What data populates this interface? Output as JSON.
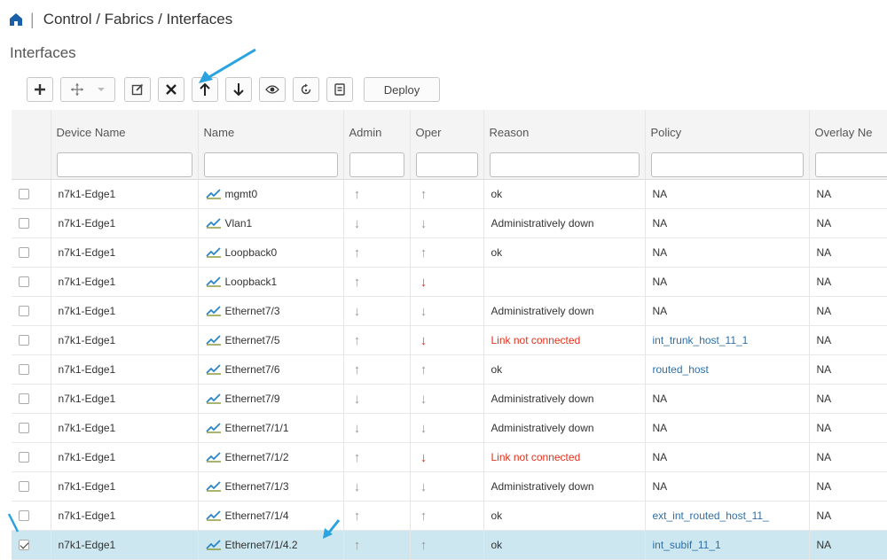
{
  "header": {
    "breadcrumb": "Control / Fabrics / Interfaces"
  },
  "section_title": "Interfaces",
  "toolbar": {
    "deploy_label": "Deploy",
    "buttons": [
      "add-icon",
      "move-icon",
      "edit-icon",
      "close-icon",
      "arrow-up-icon",
      "arrow-down-icon",
      "eye-icon",
      "refresh-icon",
      "clipboard-icon"
    ]
  },
  "table": {
    "columns": [
      "Device Name",
      "Name",
      "Admin",
      "Oper",
      "Reason",
      "Policy",
      "Overlay Ne"
    ],
    "rows": [
      {
        "device": "n7k1-Edge1",
        "name": "mgmt0",
        "admin": "up",
        "oper": "up",
        "reason": "ok",
        "policy": "NA",
        "overlay": "NA",
        "checked": false
      },
      {
        "device": "n7k1-Edge1",
        "name": "Vlan1",
        "admin": "down",
        "oper": "down",
        "reason": "Administratively down",
        "policy": "NA",
        "overlay": "NA",
        "checked": false
      },
      {
        "device": "n7k1-Edge1",
        "name": "Loopback0",
        "admin": "up",
        "oper": "up",
        "reason": "ok",
        "policy": "NA",
        "overlay": "NA",
        "checked": false
      },
      {
        "device": "n7k1-Edge1",
        "name": "Loopback1",
        "admin": "up",
        "oper": "down-red",
        "reason": "",
        "policy": "NA",
        "overlay": "NA",
        "checked": false
      },
      {
        "device": "n7k1-Edge1",
        "name": "Ethernet7/3",
        "admin": "down",
        "oper": "down",
        "reason": "Administratively down",
        "policy": "NA",
        "overlay": "NA",
        "checked": false
      },
      {
        "device": "n7k1-Edge1",
        "name": "Ethernet7/5",
        "admin": "up",
        "oper": "down-red",
        "reason": "Link not connected",
        "policy": "int_trunk_host_11_1",
        "overlay": "NA",
        "checked": false
      },
      {
        "device": "n7k1-Edge1",
        "name": "Ethernet7/6",
        "admin": "up",
        "oper": "up",
        "reason": "ok",
        "policy": "routed_host",
        "overlay": "NA",
        "checked": false
      },
      {
        "device": "n7k1-Edge1",
        "name": "Ethernet7/9",
        "admin": "down",
        "oper": "down",
        "reason": "Administratively down",
        "policy": "NA",
        "overlay": "NA",
        "checked": false
      },
      {
        "device": "n7k1-Edge1",
        "name": "Ethernet7/1/1",
        "admin": "down",
        "oper": "down",
        "reason": "Administratively down",
        "policy": "NA",
        "overlay": "NA",
        "checked": false
      },
      {
        "device": "n7k1-Edge1",
        "name": "Ethernet7/1/2",
        "admin": "up",
        "oper": "down-red",
        "reason": "Link not connected",
        "policy": "NA",
        "overlay": "NA",
        "checked": false
      },
      {
        "device": "n7k1-Edge1",
        "name": "Ethernet7/1/3",
        "admin": "down",
        "oper": "down",
        "reason": "Administratively down",
        "policy": "NA",
        "overlay": "NA",
        "checked": false
      },
      {
        "device": "n7k1-Edge1",
        "name": "Ethernet7/1/4",
        "admin": "up",
        "oper": "up",
        "reason": "ok",
        "policy": "ext_int_routed_host_11_",
        "overlay": "NA",
        "checked": false
      },
      {
        "device": "n7k1-Edge1",
        "name": "Ethernet7/1/4.2",
        "admin": "up",
        "oper": "up",
        "reason": "ok",
        "policy": "int_subif_11_1",
        "overlay": "NA",
        "checked": true
      }
    ]
  },
  "colors": {
    "accent": "#1a5fa8",
    "annotation_arrow": "#2aa3e0",
    "status_red": "#e0321e",
    "link": "#2f6fa6",
    "selected_row": "#cce7f0"
  }
}
